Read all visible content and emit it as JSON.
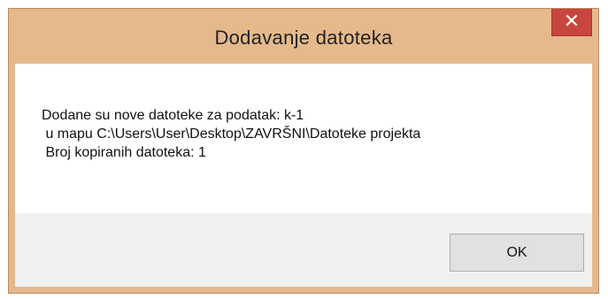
{
  "dialog": {
    "title": "Dodavanje datoteka",
    "close_symbol": "✕",
    "message_lines": [
      "Dodane su nove datoteke za podatak: k-1",
      " u mapu C:\\Users\\User\\Desktop\\ZAVRŠNI\\Datoteke projekta",
      " Broj kopiranih datoteka: 1"
    ],
    "ok_label": "OK"
  },
  "colors": {
    "frame": "#e5b98c",
    "close_button": "#c9463e",
    "footer": "#f0f0f0"
  }
}
